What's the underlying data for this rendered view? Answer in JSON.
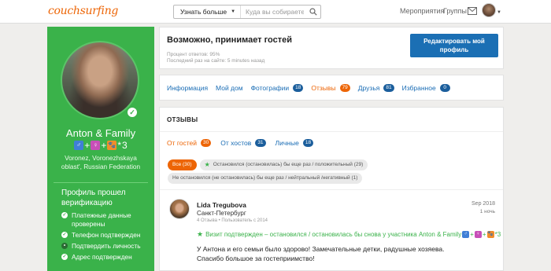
{
  "topbar": {
    "logo": "couchsurfing",
    "search_select": "Узнать больше",
    "search_placeholder": "Куда вы собираетесь г",
    "nav_events": "Мероприятия",
    "nav_groups": "Группы"
  },
  "profile": {
    "name": "Anton & Family",
    "emoji_suffix": "3",
    "location": "Voronez, Voronezhskaya oblast', Russian Federation",
    "verification_title": "Профиль прошел верификацию",
    "verification_items": [
      {
        "label": "Платежные данные проверены",
        "status": "verified"
      },
      {
        "label": "Телефон подтвержден",
        "status": "verified"
      },
      {
        "label": "Подтвердить личность",
        "status": "pending"
      },
      {
        "label": "Адрес подтвержден",
        "status": "verified"
      }
    ]
  },
  "status": {
    "title": "Возможно, принимает гостей",
    "response_rate": "Процент ответов: 95%",
    "last_login": "Последний раз на сайте: 5 minutes назад",
    "edit_button": "Редактировать мой профиль"
  },
  "tabs": [
    {
      "label": "Информация",
      "count": null,
      "active": false
    },
    {
      "label": "Мой дом",
      "count": null,
      "active": false
    },
    {
      "label": "Фотографии",
      "count": "18",
      "active": false
    },
    {
      "label": "Отзывы",
      "count": "79",
      "active": true
    },
    {
      "label": "Друзья",
      "count": "81",
      "active": false
    },
    {
      "label": "Избранное",
      "count": "0",
      "active": false
    }
  ],
  "references": {
    "header": "ОТЗЫВЫ",
    "subtabs": [
      {
        "label": "От гостей",
        "count": "30",
        "active": true
      },
      {
        "label": "От хостов",
        "count": "31",
        "active": false
      },
      {
        "label": "Личные",
        "count": "18",
        "active": false
      }
    ],
    "filters": [
      {
        "label": "Все (30)",
        "active": true,
        "star": false
      },
      {
        "label": "Остановился (остановилась) бы еще раз / положительный (29)",
        "active": false,
        "star": true
      },
      {
        "label": "Не остановился (не остановилась) бы еще раз / нейтральный /негативный (1)",
        "active": false,
        "star": false
      }
    ],
    "item": {
      "name": "Lida Tregubova",
      "city": "Санкт-Петербург",
      "meta": "4 Отзыва • Пользователь с 2014",
      "date": "Sep 2018",
      "duration": "1 ночь",
      "badge": "Визит подтвержден – остановился / остановилась бы снова у участника Anton & Family",
      "badge_suffix": "3",
      "text": "У Антона и его семьи было здорово! Замечательные детки, радушные хозяева. Спасибо большое за гостеприимство!"
    }
  },
  "colors": {
    "brand_orange": "#ed6506",
    "sidebar_green": "#3ab24a",
    "link_blue": "#1a6db5",
    "button_blue": "#1b6fb4"
  }
}
